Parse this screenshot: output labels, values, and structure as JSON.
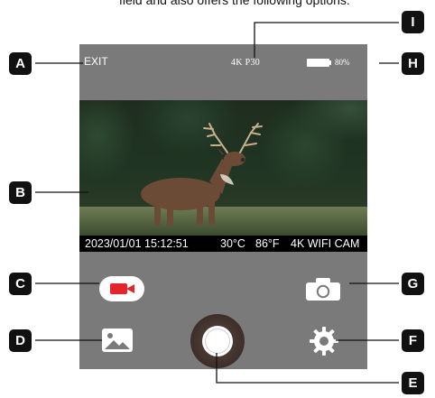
{
  "caption_fragment": "field and also offers the following options:",
  "status": {
    "exit": "EXIT",
    "resolution": "4K P30",
    "battery_level": "80%"
  },
  "video_overlay": {
    "datetime": "2023/01/01 15:12:51",
    "temp_c": "30°C",
    "temp_f": "86°F",
    "camera_name": "4K WIFI CAM"
  },
  "callout_labels": {
    "A": "A",
    "B": "B",
    "C": "C",
    "D": "D",
    "E": "E",
    "F": "F",
    "G": "G",
    "H": "H",
    "I": "I"
  },
  "colors": {
    "panel": "#7a7a7a",
    "record_red": "#e4252b",
    "label_bg": "#111111"
  },
  "icons": {
    "record": "video-record-icon",
    "camera": "camera-icon",
    "gallery": "gallery-icon",
    "settings": "gear-icon",
    "battery": "battery-icon"
  }
}
